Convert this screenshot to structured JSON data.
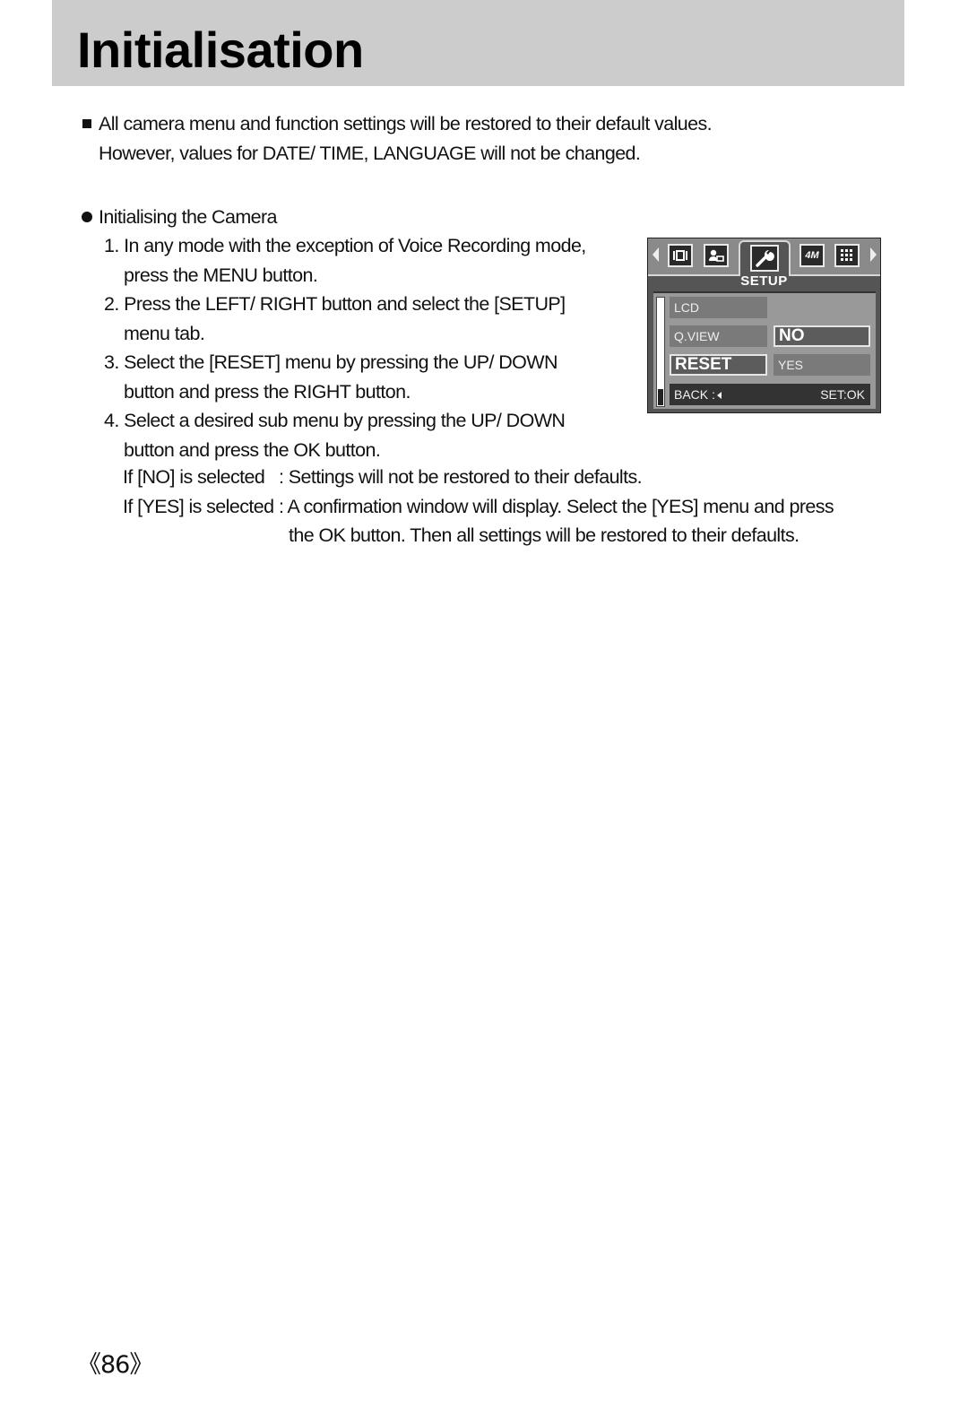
{
  "page": {
    "title": "Initialisation",
    "page_number": "《86》",
    "header_band_color": "#cccccc"
  },
  "note": {
    "line1": "All camera menu and function settings will be restored to their default values.",
    "line2": "However, values for DATE/ TIME, LANGUAGE will not be changed."
  },
  "section": {
    "heading": "Initialising the Camera",
    "steps": [
      {
        "lines": [
          "1. In any mode with the exception of Voice Recording mode,",
          "press the MENU button."
        ]
      },
      {
        "lines": [
          "2. Press the LEFT/ RIGHT button and select the [SETUP]",
          "menu tab."
        ]
      },
      {
        "lines": [
          "3. Select the [RESET] menu by pressing the UP/ DOWN",
          "button and press the RIGHT button."
        ]
      },
      {
        "lines": [
          "4. Select a desired sub menu by pressing the UP/ DOWN",
          "button and press the OK button."
        ]
      }
    ],
    "conditions": [
      {
        "label": "If [NO] is selected",
        "text": ": Settings will not be restored to their defaults.",
        "continuation": ""
      },
      {
        "label": "If [YES] is selected",
        "text": ": A confirmation window will display. Select the [YES] menu and press",
        "continuation": "the OK button. Then all settings will be restored to their defaults."
      }
    ]
  },
  "camera_screen": {
    "tabs": [
      {
        "icon": "display-mode-icon",
        "label": ""
      },
      {
        "icon": "person-settings-icon",
        "label": ""
      },
      {
        "icon": "wrench-icon",
        "label": "",
        "active": true
      },
      {
        "icon": "resolution-icon",
        "label": "4M"
      },
      {
        "icon": "quality-grid-icon",
        "label": ""
      }
    ],
    "active_tab_label": "SETUP",
    "menu_items": [
      "LCD",
      "Q.VIEW",
      "RESET"
    ],
    "selected_menu_item": "RESET",
    "sub_options": [
      "NO",
      "YES"
    ],
    "selected_sub_option": "NO",
    "back_label": "BACK :",
    "set_label": "SET:OK"
  }
}
